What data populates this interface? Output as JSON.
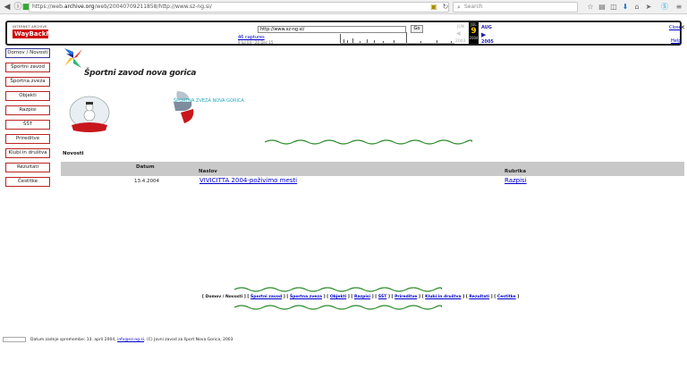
{
  "browser": {
    "url_prefix": "https://web.",
    "url_domain": "archive.org",
    "url_rest": "/web/20040709211858/http://www.sz-ng.si/",
    "search_placeholder": "Search"
  },
  "wayback": {
    "logo_line1": "INTERNET ARCHIVE",
    "logo_line2": "WayBackMachine",
    "url_value": "http://www.sz-ng.si/",
    "go_label": "Go",
    "captures": "46 captures",
    "range": "9 Jul 04 - 20 Dec 15",
    "prev_month": "JUN",
    "cur_month": "JUL",
    "day": "9",
    "year": "2004",
    "next_month": "AUG",
    "prev_year": "2003",
    "next_year": "2005",
    "close_label": "Close",
    "help_label": "Help"
  },
  "nav": [
    "Domov / Novosti",
    "Športni zavod",
    "Športna zveza",
    "Objekti",
    "Razpisi",
    "ŠŠT",
    "Prireditve",
    "Klubi in društva",
    "Rezultati",
    "Čestitke"
  ],
  "site": {
    "title": "Športni zavod nova gorica",
    "zveza": "ŠPORTNA ZVEZA NOVA GORICA"
  },
  "news": {
    "heading": "Novosti",
    "col_date": "Datum",
    "col_title": "Naslov",
    "col_rubric": "Rubrika",
    "rows": [
      {
        "date": "13.4.2004",
        "title": "VIVICITTA 2004-poživimo mesti",
        "rubric": "Razpisi"
      }
    ]
  },
  "footer_nav": {
    "current": "Domov / Novosti",
    "links": [
      "Športni zavod",
      "Športna zveza",
      "Objekti",
      "Razpisi",
      "ŠŠT",
      "Prireditve",
      "Klubi in društva",
      "Rezultati",
      "Čestitke"
    ]
  },
  "footer": {
    "prefix": "Datum zadnje spremembe: 13. april 2004,",
    "email": "info@sz-ng.si",
    "suffix": ", (C) Javni zavod za šport Nova Gorica, 2003"
  }
}
